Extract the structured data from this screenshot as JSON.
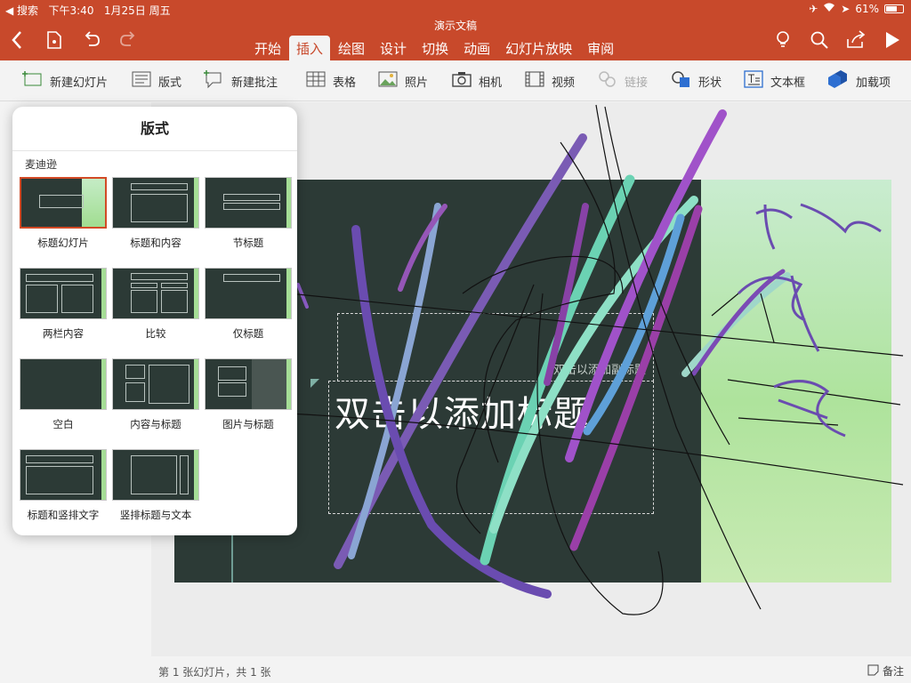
{
  "status_bar": {
    "back_label": "◀ 搜索",
    "time": "下午3:40",
    "date": "1月25日 周五",
    "battery": "61%"
  },
  "header": {
    "doc_title": "演示文稿",
    "tabs": [
      "开始",
      "插入",
      "绘图",
      "设计",
      "切换",
      "动画",
      "幻灯片放映",
      "审阅"
    ],
    "active_tab": "插入"
  },
  "ribbon": {
    "new_slide": "新建幻灯片",
    "layout": "版式",
    "new_comment": "新建批注",
    "table": "表格",
    "photo": "照片",
    "camera": "相机",
    "video": "视频",
    "link": "链接",
    "shape": "形状",
    "textbox": "文本框",
    "addins": "加载项"
  },
  "slide": {
    "title": "双击以添加标题",
    "subtitle": "双击以添加副标题"
  },
  "popover": {
    "title": "版式",
    "section": "麦迪逊",
    "layouts": [
      "标题幻灯片",
      "标题和内容",
      "节标题",
      "两栏内容",
      "比较",
      "仅标题",
      "空白",
      "内容与标题",
      "图片与标题",
      "标题和竖排文字",
      "竖排标题与文本"
    ],
    "selected": "标题幻灯片"
  },
  "bottom_bar": {
    "slide_count": "第 1 张幻灯片，共 1 张",
    "notes": "备注"
  },
  "colors": {
    "brand": "#c8492b",
    "slide_bg": "#2c3a36",
    "slide_accent": "#a5dd96"
  }
}
